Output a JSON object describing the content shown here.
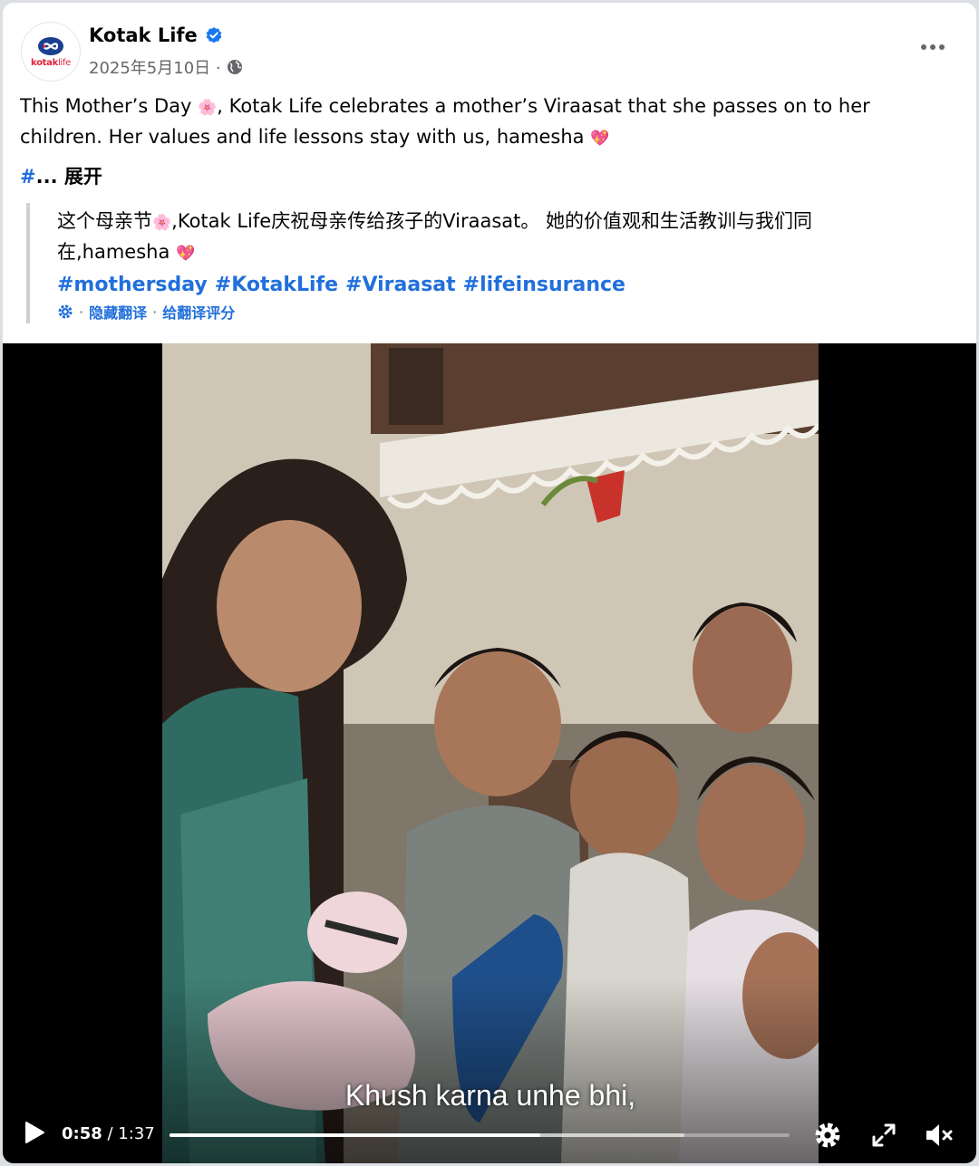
{
  "post": {
    "page_name": "Kotak Life",
    "date": "2025年5月10日 ·",
    "avatar_text_a": "kotak",
    "avatar_text_b": "life",
    "text_line1_a": "This Mother’s Day ",
    "text_emoji1": "🌸",
    "text_line1_b": ", Kotak Life celebrates a mother’s Viraasat that she passes on to her",
    "text_line2_a": "children. Her values and life lessons stay with us, hamesha ",
    "text_emoji2": "💖",
    "expand_hash": "#",
    "expand_label": "... 展开"
  },
  "translation": {
    "line1_a": "这个母亲节",
    "line1_emoji": "🌸",
    "line1_b": ",Kotak Life庆祝母亲传给孩子的Viraasat。 她的价值观和生活教训与我们同",
    "line2": "在,hamesha ",
    "line2_emoji": "💖",
    "tags": [
      "#mothersday",
      "#KotakLife",
      "#Viraasat",
      "#lifeinsurance"
    ],
    "hide_label": "隐藏翻译",
    "rate_label": "给翻译评分",
    "separator": "·"
  },
  "video": {
    "caption": "Khush karna unhe bhi,",
    "current_time": "0:58",
    "time_separator": " / ",
    "duration": "1:37",
    "progress": 0.598,
    "buffered": 0.83
  },
  "icons": {
    "more": "more-horizontal-icon",
    "verified": "verified-badge-icon",
    "globe": "globe-icon",
    "translate_settings": "gear-icon",
    "play": "play-icon",
    "settings": "gear-icon",
    "fullscreen": "fullscreen-icon",
    "mute": "volume-muted-icon"
  },
  "colors": {
    "link": "#216fdb",
    "verified": "#1877f2",
    "brand_red": "#e0223a",
    "brand_blue": "#1a3f8f"
  }
}
